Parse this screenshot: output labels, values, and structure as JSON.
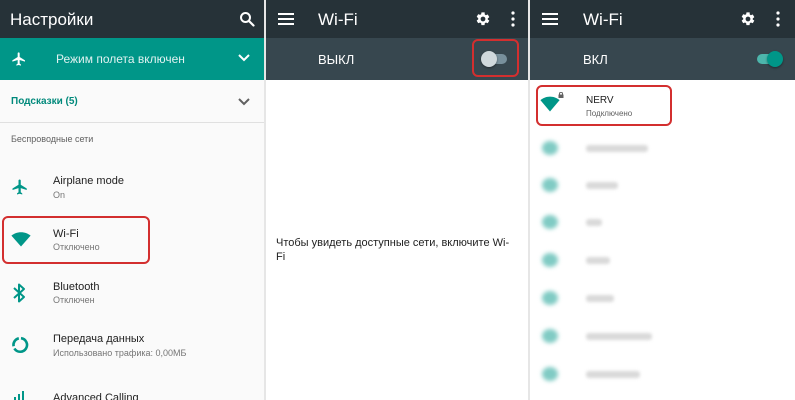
{
  "settings": {
    "title": "Настройки",
    "icons": {
      "search": "search-icon",
      "airplane": "airplane-icon",
      "chevron": "chevron-down-icon"
    },
    "airplane_banner": "Режим полета включен",
    "suggestions": "Подсказки (5)",
    "section_header": "Беспроводные сети",
    "items": [
      {
        "title": "Airplane mode",
        "subtitle": "On",
        "icon": "airplane-icon"
      },
      {
        "title": "Wi-Fi",
        "subtitle": "Отключено",
        "icon": "wifi-icon"
      },
      {
        "title": "Bluetooth",
        "subtitle": "Отключен",
        "icon": "bluetooth-icon"
      },
      {
        "title": "Передача данных",
        "subtitle": "Использовано трафика: 0,00МБ",
        "icon": "data-usage-icon"
      },
      {
        "title": "Advanced Calling",
        "subtitle": "",
        "icon": "phone-icon"
      }
    ]
  },
  "wifi_off": {
    "title": "Wi-Fi",
    "status": "ВЫКЛ",
    "toggle_on": false,
    "message_line1": "Чтобы увидеть доступные сети, включите Wi-",
    "message_line2": "Fi"
  },
  "wifi_on": {
    "title": "Wi-Fi",
    "status": "ВКЛ",
    "toggle_on": true,
    "connected_network": {
      "name": "NERV",
      "status": "Подключено"
    },
    "blurred_network_count": 7
  },
  "colors": {
    "appbar": "#263238",
    "subbar": "#37474f",
    "accent": "#009688",
    "banner": "#009688",
    "highlight": "#d32f2f"
  }
}
